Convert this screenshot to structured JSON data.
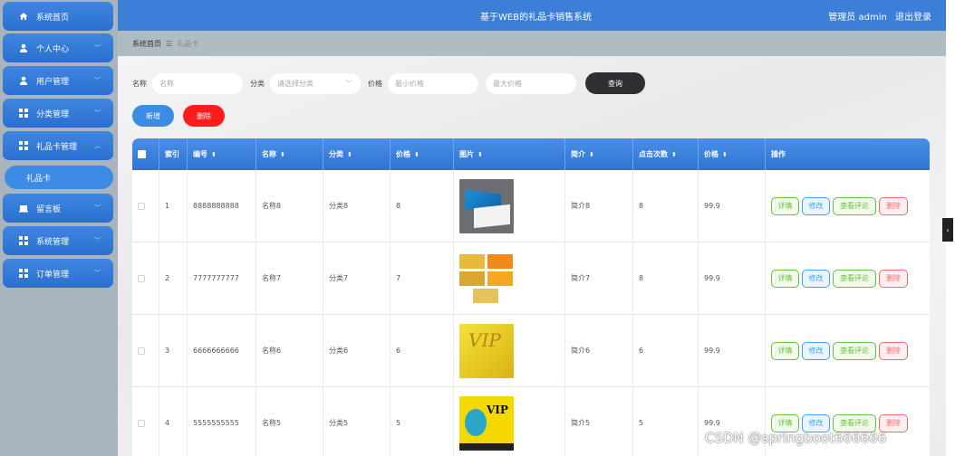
{
  "app_title": "基于WEB的礼品卡销售系统",
  "user": {
    "role": "管理员 admin",
    "logout": "退出登录"
  },
  "sidebar": {
    "items": [
      {
        "label": "系统首页",
        "icon": "home-icon",
        "expanded": false
      },
      {
        "label": "个人中心",
        "icon": "person-icon",
        "expanded": false
      },
      {
        "label": "用户管理",
        "icon": "person-icon",
        "expanded": false
      },
      {
        "label": "分类管理",
        "icon": "grid-icon",
        "expanded": false
      },
      {
        "label": "礼品卡管理",
        "icon": "grid-icon",
        "expanded": true
      },
      {
        "label": "留言板",
        "icon": "board-icon",
        "expanded": false
      },
      {
        "label": "系统管理",
        "icon": "grid-icon",
        "expanded": false
      },
      {
        "label": "订单管理",
        "icon": "grid-icon",
        "expanded": false
      }
    ],
    "active_sub": "礼品卡"
  },
  "breadcrumb": {
    "home": "系统首页",
    "separator": "☰",
    "current": "礼品卡"
  },
  "search": {
    "name_label": "名称",
    "name_placeholder": "名称",
    "category_label": "分类",
    "category_placeholder": "请选择分类",
    "price_label": "价格",
    "min_placeholder": "最小价格",
    "max_placeholder": "最大价格",
    "query_button": "查询"
  },
  "actions": {
    "add": "新增",
    "delete": "删除"
  },
  "table": {
    "columns": [
      "索引",
      "编号",
      "名称",
      "分类",
      "价格",
      "图片",
      "简介",
      "点击次数",
      "价格",
      "操作"
    ],
    "rows": [
      {
        "index": "1",
        "code": "8888888888",
        "name": "名称8",
        "category": "分类8",
        "price": "8",
        "intro": "简介8",
        "clicks": "8",
        "price2": "99.9",
        "image": "blue-card"
      },
      {
        "index": "2",
        "code": "7777777777",
        "name": "名称7",
        "category": "分类7",
        "price": "7",
        "intro": "简介7",
        "clicks": "8",
        "price2": "99.9",
        "image": "orange-cards"
      },
      {
        "index": "3",
        "code": "6666666666",
        "name": "名称6",
        "category": "分类6",
        "price": "6",
        "intro": "简介6",
        "clicks": "6",
        "price2": "99.9",
        "image": "gold-vip-card"
      },
      {
        "index": "4",
        "code": "5555555555",
        "name": "名称5",
        "category": "分类5",
        "price": "5",
        "intro": "简介5",
        "clicks": "5",
        "price2": "99.9",
        "image": "yellow-vip-card"
      }
    ],
    "ops": {
      "detail": "详情",
      "edit": "修改",
      "comment": "查看评论",
      "delete": "删除"
    }
  },
  "watermark": "CSDN @springboot666666",
  "colors": {
    "primary": "#3b7fd8",
    "header_bg": "#3b7fd8",
    "sidebar_bg": "#a9b4bd",
    "danger": "#ff1c1c",
    "query_btn": "#2d2f33"
  }
}
